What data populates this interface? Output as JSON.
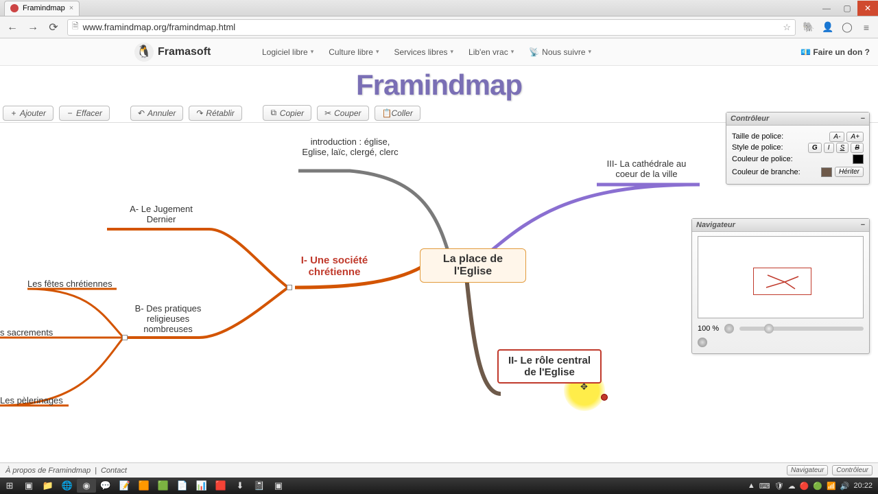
{
  "browser": {
    "tab_title": "Framindmap",
    "url": "www.framindmap.org/framindmap.html"
  },
  "site_menu": {
    "brand": "Framasoft",
    "items": [
      "Logiciel libre",
      "Culture libre",
      "Services libres",
      "Lib'en vrac",
      "Nous suivre"
    ],
    "donate": "Faire un don ?"
  },
  "app_title": "Framindmap",
  "toolbar": {
    "add": "Ajouter",
    "delete": "Effacer",
    "undo": "Annuler",
    "redo": "Rétablir",
    "copy": "Copier",
    "cut": "Couper",
    "paste": "Coller"
  },
  "mindmap": {
    "root": "La place de l'Eglise",
    "intro": "introduction : église, Eglise, laïc, clergé, clerc",
    "n_iii": "III- La cathédrale au coeur de la ville",
    "n_i": "I- Une société chrétienne",
    "n_ii": "II- Le rôle central de l'Eglise",
    "n_a": "A- Le Jugement Dernier",
    "n_b": "B- Des pratiques religieuses nombreuses",
    "n_fetes": "Les fêtes chrétiennes",
    "n_sacr": "s sacrements",
    "n_peler": "Les pèlerinages"
  },
  "controller": {
    "title": "Contrôleur",
    "font_size": "Taille de police:",
    "font_style": "Style de police:",
    "font_color": "Couleur de police:",
    "branch_color": "Couleur de branche:",
    "inherit": "Hériter",
    "g": "G",
    "i": "I",
    "s": "S",
    "b": "B",
    "a_minus": "A-",
    "a_plus": "A+"
  },
  "navigator": {
    "title": "Navigateur",
    "zoom": "100 %"
  },
  "footer": {
    "about": "À propos de Framindmap",
    "contact": "Contact",
    "nav_btn": "Navigateur",
    "ctrl_btn": "Contrôleur"
  },
  "clock": "20:22"
}
